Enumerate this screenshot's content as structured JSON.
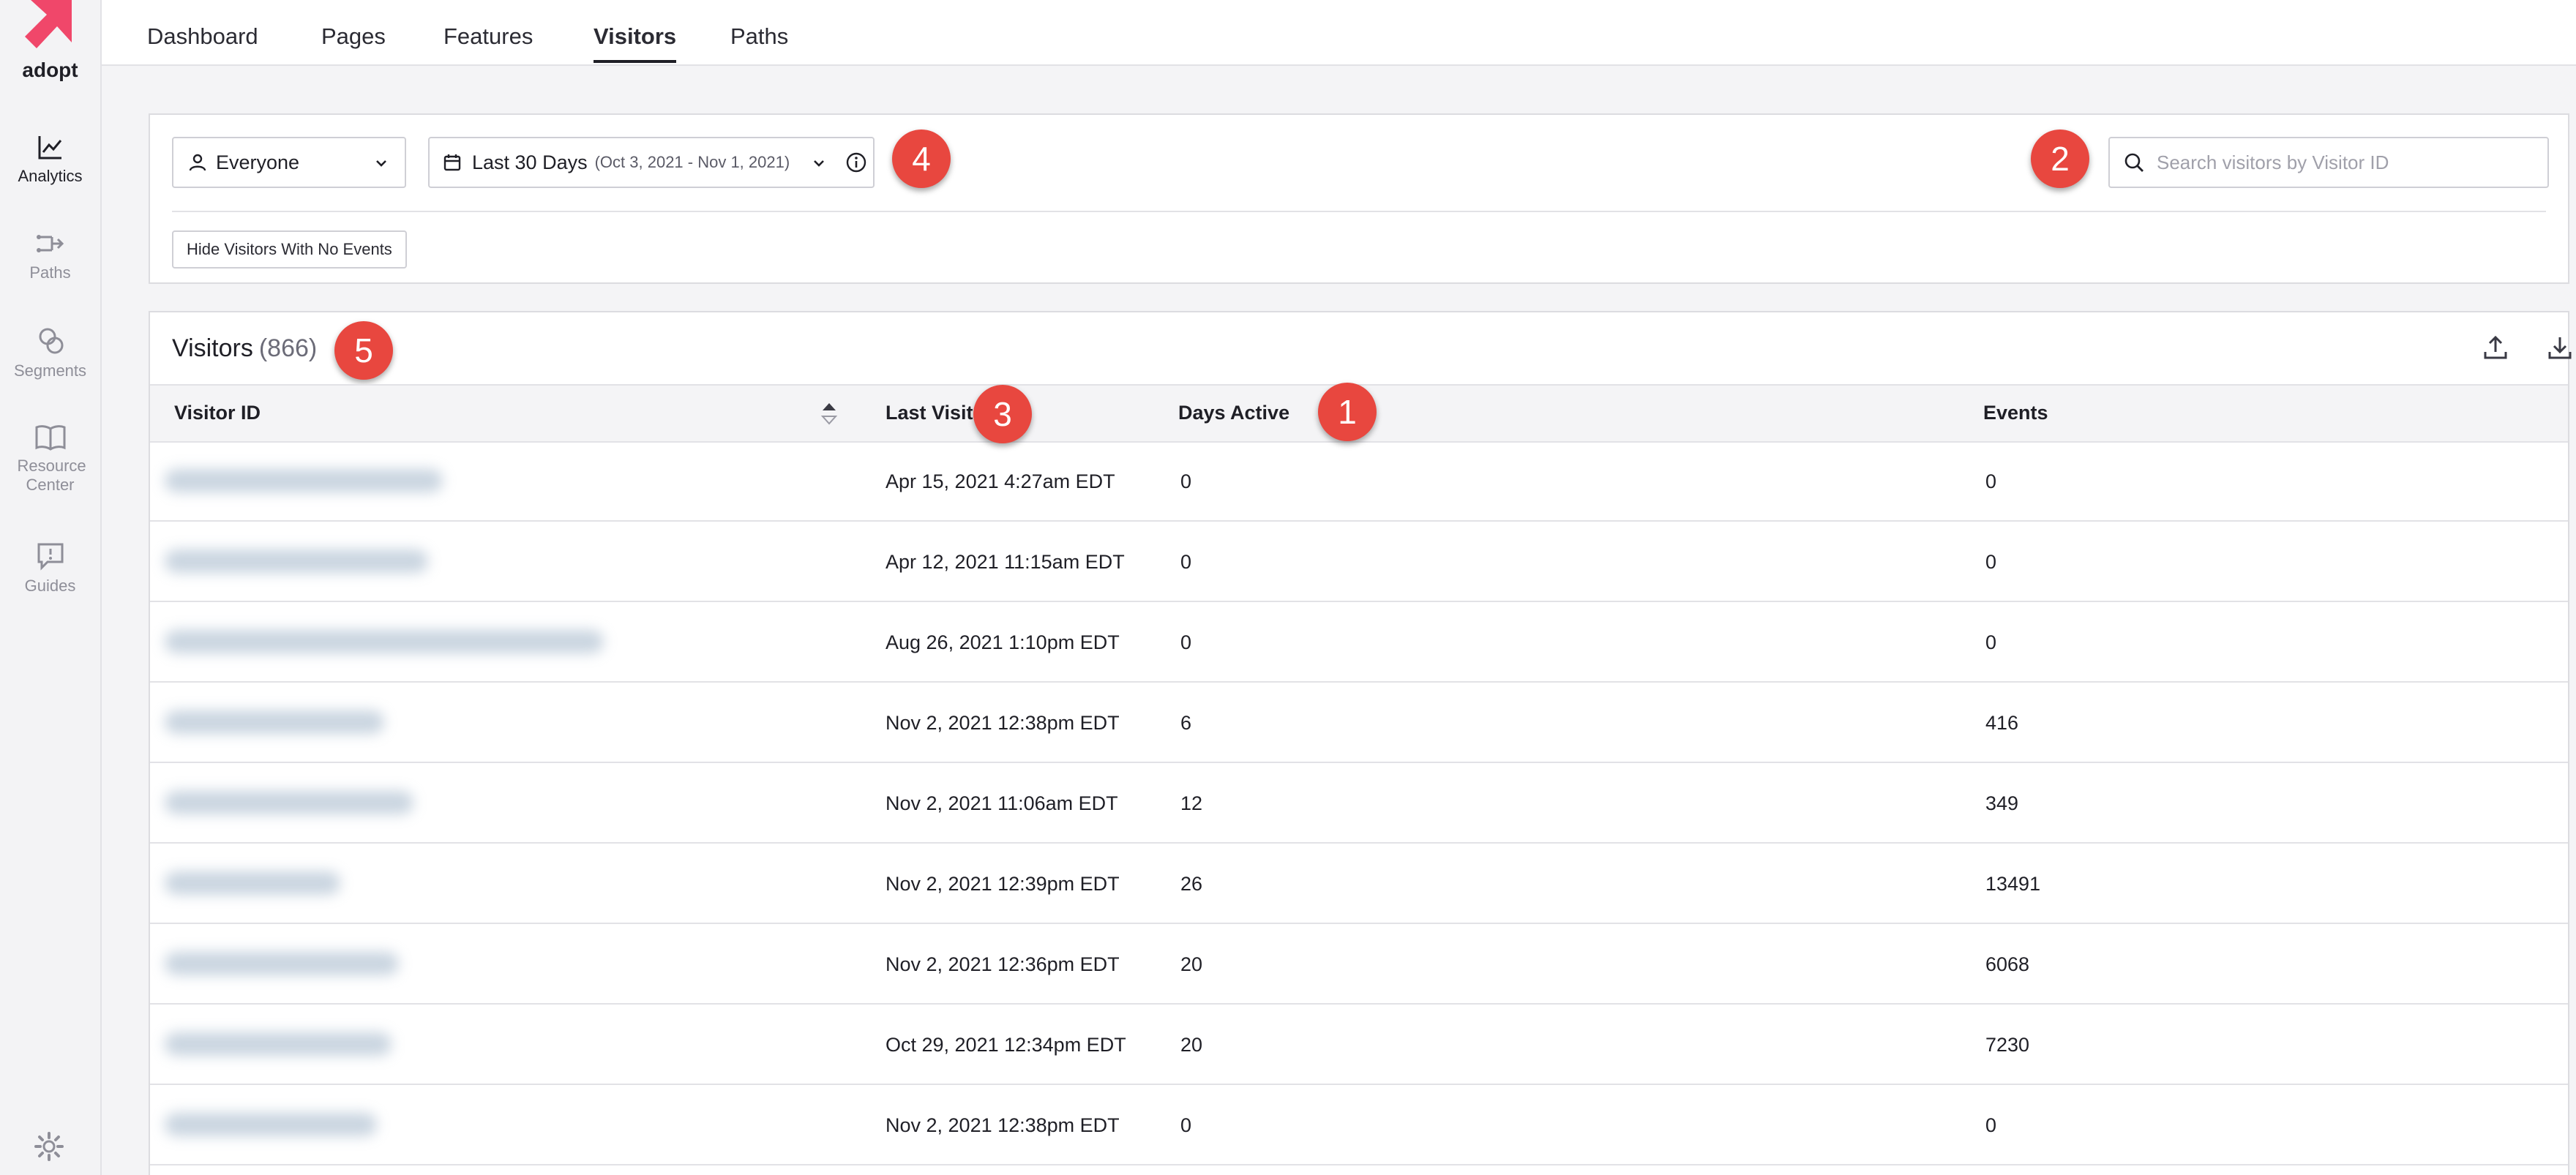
{
  "app": {
    "logo_text": "adopt",
    "brand_color": "#f0476a"
  },
  "sidebar": {
    "items": [
      {
        "label": "Analytics",
        "icon": "chart-line-icon",
        "active": true
      },
      {
        "label": "Paths",
        "icon": "paths-icon",
        "active": false
      },
      {
        "label": "Segments",
        "icon": "segments-icon",
        "active": false
      },
      {
        "label": "Resource Center",
        "icon": "book-open-icon",
        "active": false
      },
      {
        "label": "Guides",
        "icon": "guides-icon",
        "active": false
      }
    ],
    "settings_icon": "gear-icon"
  },
  "tabs": [
    {
      "label": "Dashboard",
      "active": false
    },
    {
      "label": "Pages",
      "active": false
    },
    {
      "label": "Features",
      "active": false
    },
    {
      "label": "Visitors",
      "active": true
    },
    {
      "label": "Paths",
      "active": false
    }
  ],
  "filters": {
    "segment": "Everyone",
    "date_range": "Last 30 Days",
    "date_sub": "(Oct 3, 2021 - Nov 1, 2021)",
    "search_placeholder": "Search visitors by Visitor ID",
    "hide_button": "Hide Visitors With No Events"
  },
  "badges": [
    "1",
    "2",
    "3",
    "4",
    "5"
  ],
  "visitors": {
    "title": "Visitors",
    "count": "(866)",
    "columns": [
      "Visitor ID",
      "Last Visit",
      "Days Active",
      "Events"
    ],
    "rows": [
      {
        "last_visit": "Apr 15, 2021 4:27am EDT",
        "days_active": "0",
        "events": "0"
      },
      {
        "last_visit": "Apr 12, 2021 11:15am EDT",
        "days_active": "0",
        "events": "0"
      },
      {
        "last_visit": "Aug 26, 2021 1:10pm EDT",
        "days_active": "0",
        "events": "0"
      },
      {
        "last_visit": "Nov 2, 2021 12:38pm EDT",
        "days_active": "6",
        "events": "416"
      },
      {
        "last_visit": "Nov 2, 2021 11:06am EDT",
        "days_active": "12",
        "events": "349"
      },
      {
        "last_visit": "Nov 2, 2021 12:39pm EDT",
        "days_active": "26",
        "events": "13491"
      },
      {
        "last_visit": "Nov 2, 2021 12:36pm EDT",
        "days_active": "20",
        "events": "6068"
      },
      {
        "last_visit": "Oct 29, 2021 12:34pm EDT",
        "days_active": "20",
        "events": "7230"
      },
      {
        "last_visit": "Nov 2, 2021 12:38pm EDT",
        "days_active": "0",
        "events": "0"
      }
    ]
  }
}
